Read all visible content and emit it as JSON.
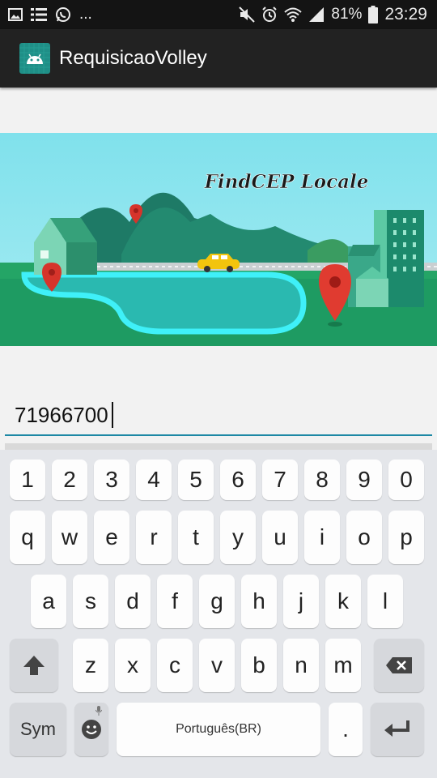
{
  "status_bar": {
    "overflow": "...",
    "battery": "81%",
    "time": "23:29",
    "left_icons": [
      "image-icon",
      "list-icon",
      "whatsapp-icon"
    ],
    "right_icons": [
      "mute-icon",
      "alarm-icon",
      "wifi-icon",
      "signal-icon",
      "battery-icon"
    ]
  },
  "app_bar": {
    "title": "RequisicaoVolley",
    "icon": "android-icon"
  },
  "banner": {
    "title": "FindCEP Locale"
  },
  "cep_input": {
    "value": "71966700"
  },
  "keyboard": {
    "rows": [
      [
        "1",
        "2",
        "3",
        "4",
        "5",
        "6",
        "7",
        "8",
        "9",
        "0"
      ],
      [
        "q",
        "w",
        "e",
        "r",
        "t",
        "y",
        "u",
        "i",
        "o",
        "p"
      ],
      [
        "a",
        "s",
        "d",
        "f",
        "g",
        "h",
        "j",
        "k",
        "l"
      ],
      [
        "z",
        "x",
        "c",
        "v",
        "b",
        "n",
        "m"
      ]
    ],
    "sym_label": "Sym",
    "space_label": "Português(BR)",
    "period_label": ".",
    "icons": [
      "shift-icon",
      "backspace-icon",
      "emoji-icon",
      "mic-icon",
      "enter-icon"
    ]
  },
  "colors": {
    "status_bar": "#141414",
    "app_bar": "#222222",
    "input_underline": "#1d88a5",
    "keyboard_bg": "#e4e6ea",
    "key_bg": "#fdfdfd"
  }
}
